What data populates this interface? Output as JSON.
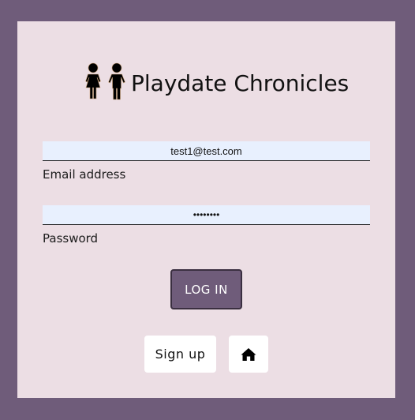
{
  "app": {
    "title": "Playdate Chronicles",
    "logo_icon": "two-children-icon"
  },
  "login_form": {
    "email": {
      "value": "test1@test.com",
      "label": "Email address"
    },
    "password": {
      "value": "password",
      "label": "Password"
    },
    "login_button": "LOG IN"
  },
  "actions": {
    "signup_button": "Sign up",
    "home_icon": "home-icon"
  },
  "colors": {
    "page_background": "#6f5c7a",
    "card_background": "#ecdee4",
    "input_background": "#e8f0fe",
    "primary_button": "#6f5c7a"
  }
}
